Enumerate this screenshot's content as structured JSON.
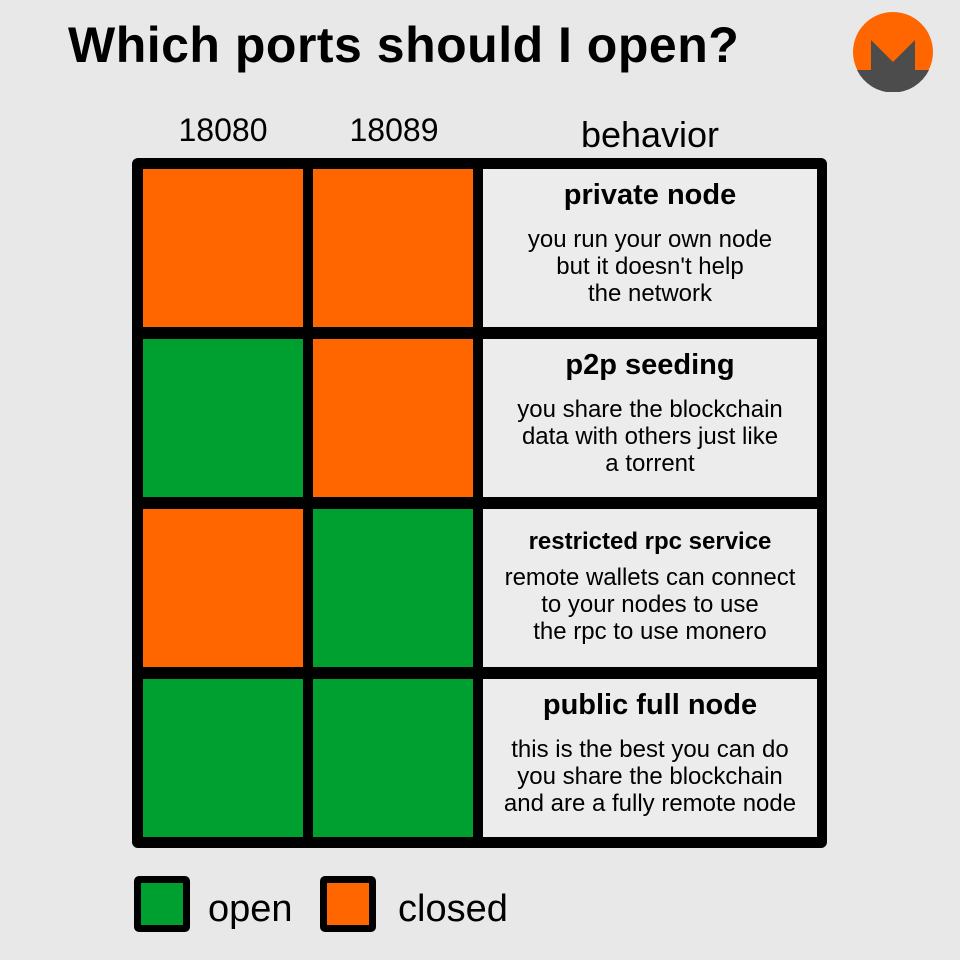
{
  "title": "Which ports should I open?",
  "columns": {
    "port1": "18080",
    "port2": "18089",
    "behavior": "behavior"
  },
  "colors": {
    "open": "#00a030",
    "closed": "#ff6600",
    "border": "#000000",
    "background": "#e8e8e8"
  },
  "rows": [
    {
      "port_18080": "closed",
      "port_18089": "closed",
      "name": "private node",
      "text": "you run your own node\nbut it doesn't help\nthe network"
    },
    {
      "port_18080": "open",
      "port_18089": "closed",
      "name": "p2p seeding",
      "text": "you share the blockchain\ndata with others just like\na torrent"
    },
    {
      "port_18080": "closed",
      "port_18089": "open",
      "name": "restricted rpc service",
      "text": "remote wallets can connect\nto your nodes to use\nthe rpc to use monero"
    },
    {
      "port_18080": "open",
      "port_18089": "open",
      "name": "public full node",
      "text": "this is the best you can do\nyou share the blockchain\nand are a fully remote node"
    }
  ],
  "legend": {
    "open": "open",
    "closed": "closed"
  },
  "logo": "monero-logo-icon"
}
